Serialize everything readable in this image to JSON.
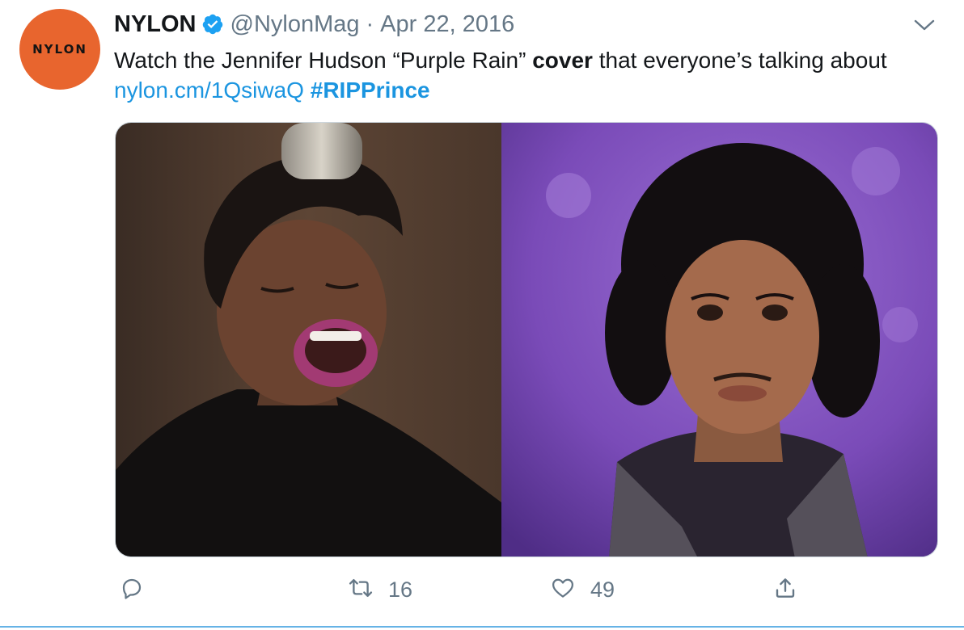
{
  "account": {
    "avatar_text": "NYLON",
    "name": "NYLON",
    "handle": "@NylonMag",
    "separator": "·",
    "date": "Apr 22, 2016",
    "verified": true
  },
  "tweet": {
    "text_before": "Watch the Jennifer Hudson “Purple Rain” ",
    "text_bold": "cover",
    "text_after": " that everyone’s talking about ",
    "link": "nylon.cm/1QsiwaQ",
    "hashtag": "#RIPPrince"
  },
  "media": {
    "left_photo": "Jennifer Hudson singing into a studio microphone",
    "right_photo": "Prince portrait on purple background"
  },
  "actions": {
    "reply_count": "",
    "retweet_count": "16",
    "like_count": "49"
  },
  "colors": {
    "brand_orange": "#e8652e",
    "link_blue": "#1b95e0",
    "verified_blue": "#1da1f2",
    "muted_gray": "#657786"
  },
  "icons": [
    "verified-badge-icon",
    "chevron-down-icon",
    "reply-icon",
    "retweet-icon",
    "like-icon",
    "share-icon"
  ]
}
